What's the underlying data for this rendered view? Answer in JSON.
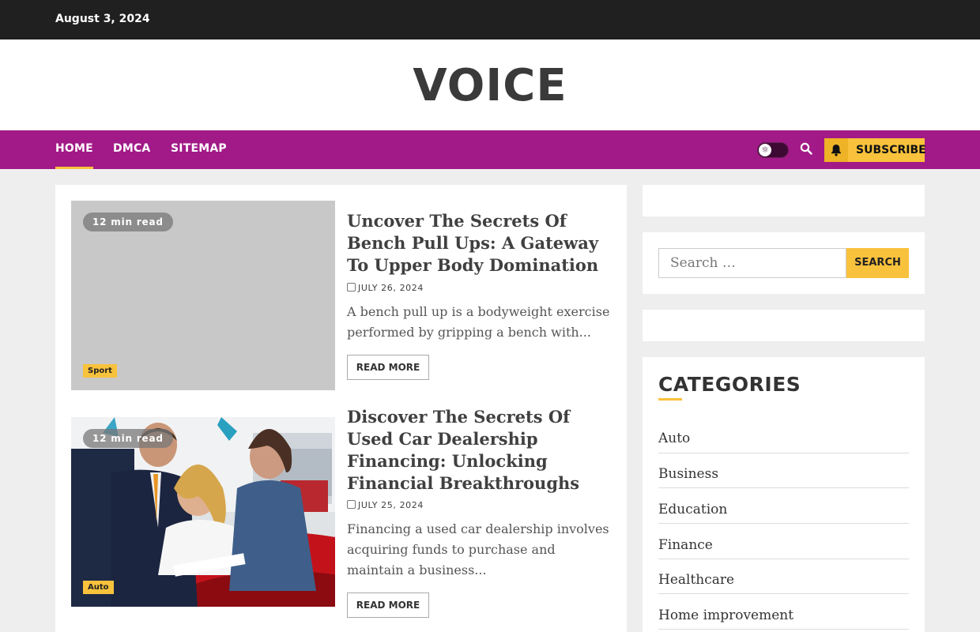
{
  "topbar": {
    "date": "August 3, 2024"
  },
  "site": {
    "title": "VOICE"
  },
  "nav": {
    "items": [
      "Home",
      "DMCA",
      "Sitemap"
    ],
    "active": "Home",
    "subscribe_label": "SUBSCRIBE",
    "icons": {
      "theme_toggle": "sun-icon",
      "search": "search-icon",
      "subscribe": "bell-icon"
    }
  },
  "posts": [
    {
      "read_time": "12 min read",
      "category": "Sport",
      "title": "Uncover The Secrets Of Bench Pull Ups: A Gateway To Upper Body Domination",
      "date": "JULY 26, 2024",
      "excerpt": "A bench pull up is a bodyweight exercise performed by gripping a bench with...",
      "read_more": "READ MORE"
    },
    {
      "read_time": "12 min read",
      "category": "Auto",
      "title": "Discover The Secrets Of Used Car Dealership Financing: Unlocking Financial Breakthroughs",
      "date": "JULY 25, 2024",
      "excerpt": "Financing a used car dealership involves acquiring funds to purchase and maintain a business...",
      "read_more": "READ MORE"
    }
  ],
  "search_widget": {
    "placeholder": "Search …",
    "button": "SEARCH"
  },
  "categories": {
    "title": "CATEGORIES",
    "items": [
      "Auto",
      "Business",
      "Education",
      "Finance",
      "Healthcare",
      "Home improvement"
    ]
  },
  "colors": {
    "accent": "#a21a87",
    "highlight": "#f9c23c",
    "topbar": "#202020"
  }
}
